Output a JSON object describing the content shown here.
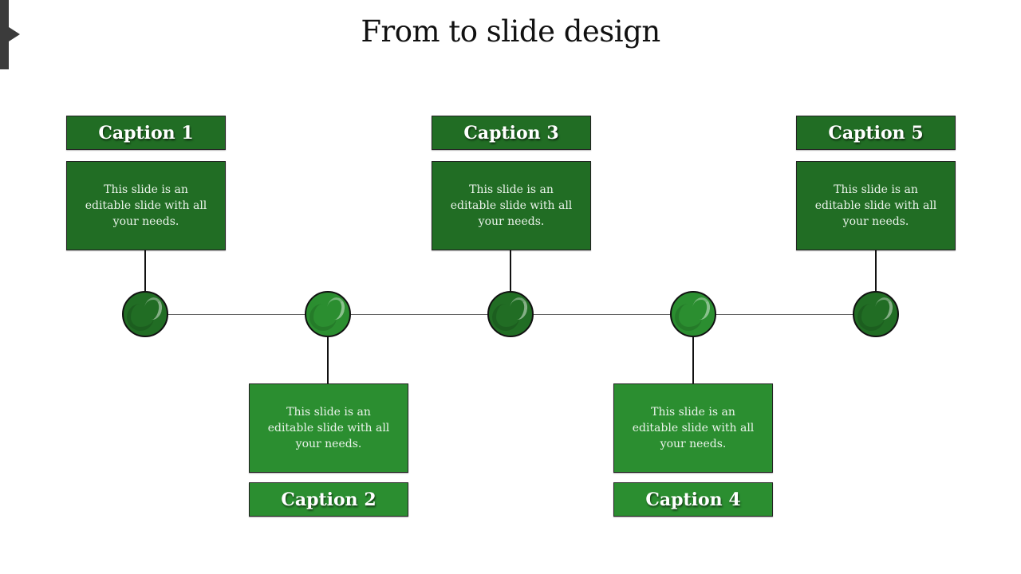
{
  "slide": {
    "title": "From to slide design"
  },
  "colors": {
    "dark_green": "#216d24",
    "light_green": "#2b8e30",
    "outline": "#111111",
    "timeline": "#666666"
  },
  "milestones": [
    {
      "caption": "Caption 1",
      "text": "This slide is an editable slide with all your needs.",
      "position": "top",
      "color": "dark"
    },
    {
      "caption": "Caption 2",
      "text": "This slide is an editable slide with all your needs.",
      "position": "bottom",
      "color": "light"
    },
    {
      "caption": "Caption 3",
      "text": "This slide is an editable slide with all your needs.",
      "position": "top",
      "color": "dark"
    },
    {
      "caption": "Caption 4",
      "text": "This slide is an editable slide with all your needs.",
      "position": "bottom",
      "color": "light"
    },
    {
      "caption": "Caption 5",
      "text": "This slide is an editable slide with all your needs.",
      "position": "top",
      "color": "dark"
    }
  ]
}
